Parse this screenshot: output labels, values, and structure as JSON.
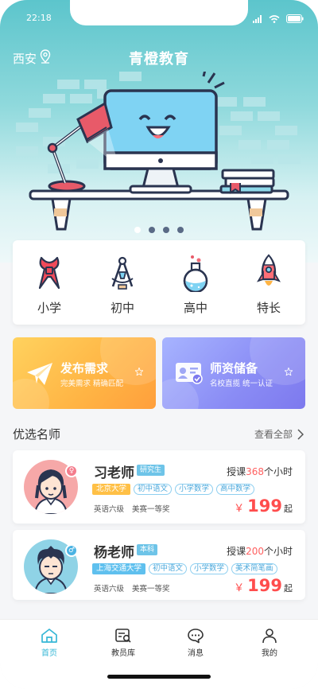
{
  "status": {
    "time": "22:18"
  },
  "header": {
    "city": "西安",
    "title": "青橙教育"
  },
  "carousel": {
    "count": 4,
    "active": 0
  },
  "categories": [
    {
      "label": "小学",
      "icon": "red-scarf-icon"
    },
    {
      "label": "初中",
      "icon": "compass-icon"
    },
    {
      "label": "高中",
      "icon": "flask-icon"
    },
    {
      "label": "特长",
      "icon": "rocket-icon"
    }
  ],
  "banners": [
    {
      "title": "发布需求",
      "subtitle": "完美需求  精确匹配",
      "icon": "paper-plane-icon"
    },
    {
      "title": "师资储备",
      "subtitle": "名校直揽  统一认证",
      "icon": "id-card-icon"
    }
  ],
  "section": {
    "title": "优选名师",
    "more": "查看全部"
  },
  "teachers": [
    {
      "name": "习老师",
      "degree": "研究生",
      "hours_prefix": "授课",
      "hours": "368",
      "hours_suffix": "个小时",
      "school": "北京大学",
      "subjects": [
        "初中语文",
        "小学数学",
        "高中数学"
      ],
      "skill": "英语六级",
      "award": "美赛一等奖",
      "price_symbol": "￥",
      "price": "199",
      "price_unit": "起",
      "gender": "female"
    },
    {
      "name": "杨老师",
      "degree": "本科",
      "hours_prefix": "授课",
      "hours": "200",
      "hours_suffix": "个小时",
      "school": "上海交通大学",
      "subjects": [
        "初中语文",
        "小学数学",
        "美术简笔画"
      ],
      "skill": "英语六级",
      "award": "美赛一等奖",
      "price_symbol": "￥",
      "price": "199",
      "price_unit": "起",
      "gender": "male"
    }
  ],
  "tabbar": [
    {
      "label": "首页",
      "icon": "home-icon",
      "active": true
    },
    {
      "label": "教员库",
      "icon": "teacher-search-icon",
      "active": false
    },
    {
      "label": "消息",
      "icon": "message-icon",
      "active": false
    },
    {
      "label": "我的",
      "icon": "profile-icon",
      "active": false
    }
  ],
  "colors": {
    "accent": "#36b7d6",
    "price": "#ff4d4d",
    "orange": "#ffb444",
    "purple": "#8a8cf5"
  }
}
